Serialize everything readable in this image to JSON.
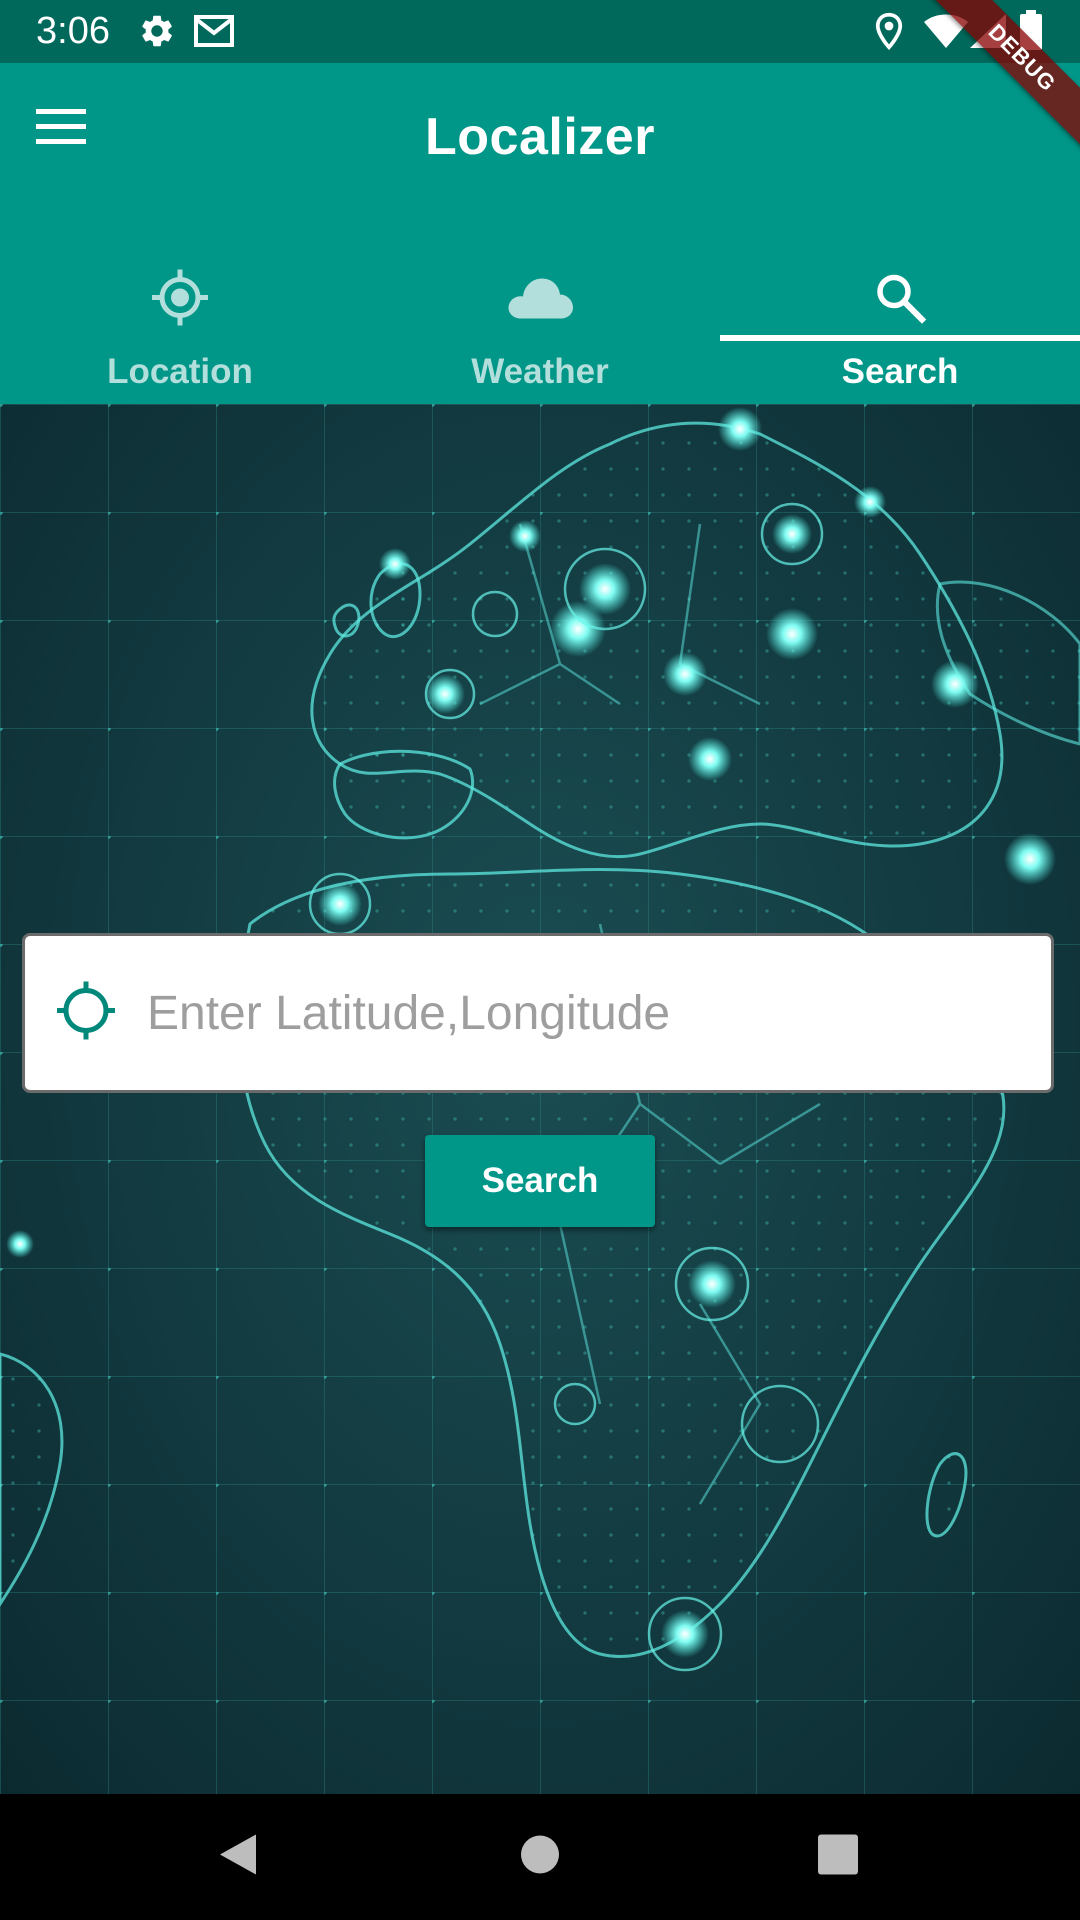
{
  "status_bar": {
    "time": "3:06",
    "left_icons": [
      "settings-icon",
      "gmail-icon"
    ],
    "right_icons": [
      "location-pin-icon",
      "wifi-icon",
      "signal-icon",
      "battery-icon"
    ]
  },
  "app_bar": {
    "title": "Localizer",
    "menu_icon": "hamburger-menu-icon"
  },
  "tabs": [
    {
      "label": "Location",
      "icon": "gps-fixed-icon",
      "active": false
    },
    {
      "label": "Weather",
      "icon": "cloud-icon",
      "active": false
    },
    {
      "label": "Search",
      "icon": "search-icon",
      "active": true
    }
  ],
  "search": {
    "placeholder": "Enter Latitude,Longitude",
    "value": "",
    "icon": "gps-crosshair-icon",
    "button_label": "Search"
  },
  "debug_banner": "DEBUG",
  "nav_bar": {
    "buttons": [
      "back-icon",
      "home-icon",
      "recents-icon"
    ]
  },
  "colors": {
    "primary": "#009688",
    "primary_dark": "#00695c",
    "inactive_tab": "#b2dfdb",
    "map_glow": "#4ef2e4"
  }
}
